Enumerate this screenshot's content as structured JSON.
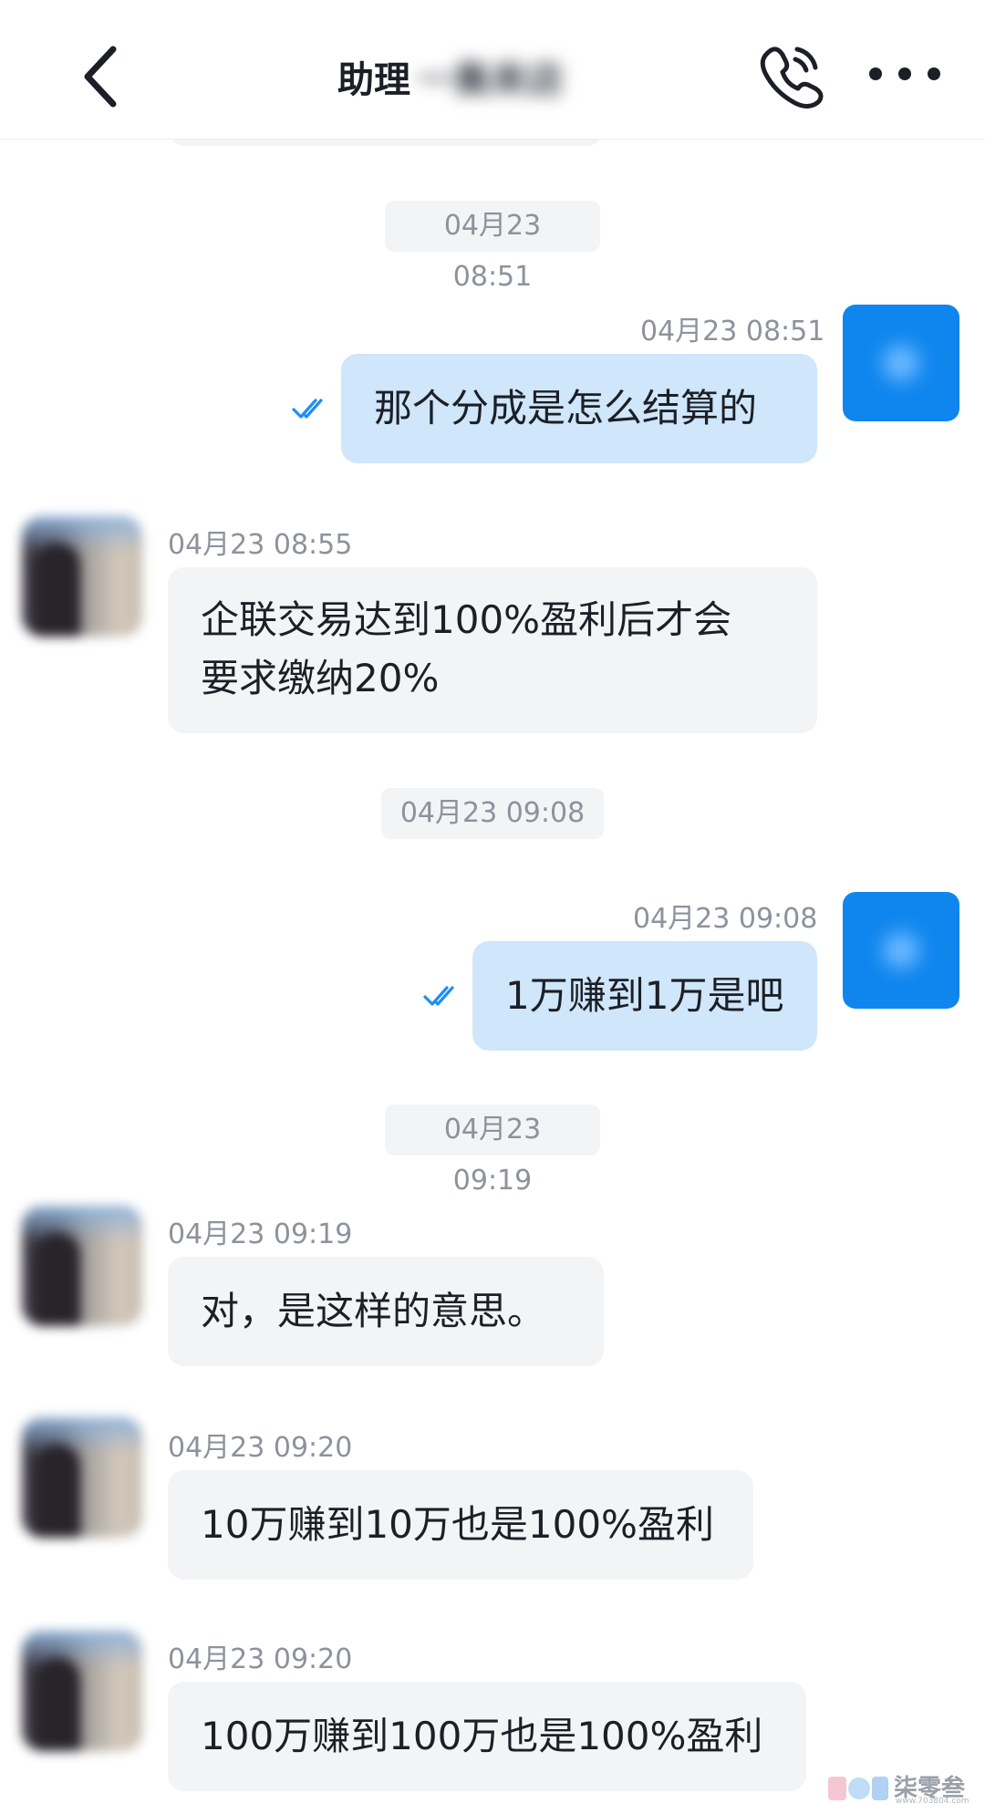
{
  "header": {
    "title": "助理",
    "title_obscured": "一集来店",
    "back_icon": "chevron-left-icon",
    "call_icon": "phone-icon",
    "more_icon": "ellipsis-icon"
  },
  "messages": [
    {
      "kind": "timestamp",
      "text": "04月23 08:51"
    },
    {
      "kind": "sent",
      "time": "04月23 08:51",
      "text": "那个分成是怎么结算的",
      "status": "read"
    },
    {
      "kind": "received",
      "time": "04月23 08:55",
      "lines": [
        "企联交易达到100%盈利后才会",
        "要求缴纳20%"
      ]
    },
    {
      "kind": "timestamp",
      "text": "04月23 09:08"
    },
    {
      "kind": "sent",
      "time": "04月23 09:08",
      "text": "1万赚到1万是吧",
      "status": "read"
    },
    {
      "kind": "timestamp",
      "text": "04月23 09:19"
    },
    {
      "kind": "received",
      "time": "04月23 09:19",
      "text": "对，是这样的意思。"
    },
    {
      "kind": "received",
      "time": "04月23 09:20",
      "text": "10万赚到10万也是100%盈利"
    },
    {
      "kind": "received",
      "time": "04月23 09:20",
      "text": "100万赚到100万也是100%盈利"
    }
  ],
  "watermark": {
    "text": "柒零叁",
    "url": "www.703804.com"
  },
  "colors": {
    "sent_bubble": "#cfe6fb",
    "received_bubble": "#f2f4f6",
    "self_avatar": "#0f86ee",
    "read_check": "#1f8ff0",
    "timestamp_text": "#8d929c"
  }
}
